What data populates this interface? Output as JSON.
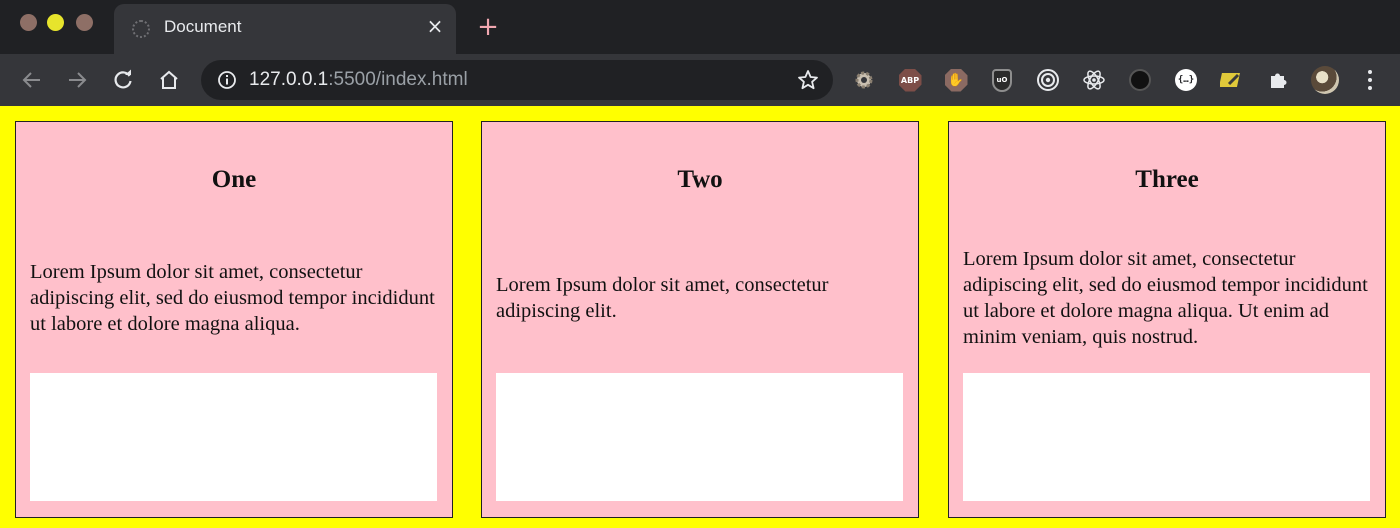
{
  "browser": {
    "tab_title": "Document",
    "tab_close": "×",
    "new_tab": "+",
    "url_host": "127.0.0.1",
    "url_rest": ":5500/index.html",
    "extensions": [
      "settings-gear",
      "adblock-plus",
      "hand-stop",
      "ublock-origin",
      "target",
      "react-devtools",
      "dark-reader",
      "json-viewer",
      "yellow-pencil",
      "extensions-puzzle"
    ],
    "colors": {
      "tabstrip": "#202124",
      "toolbar": "#35363a",
      "omnibox": "#202124"
    }
  },
  "cards": [
    {
      "title": "One",
      "text": "Lorem Ipsum dolor sit amet, consectetur adipiscing elit, sed do eiusmod tempor incididunt ut labore et dolore magna aliqua."
    },
    {
      "title": "Two",
      "text": "Lorem Ipsum dolor sit amet, consectetur adipiscing elit."
    },
    {
      "title": "Three",
      "text": "Lorem Ipsum dolor sit amet, consectetur adipiscing elit, sed do eiusmod tempor incididunt ut labore et dolore magna aliqua. Ut enim ad minim veniam, quis nostrud."
    }
  ],
  "colors": {
    "page_background": "#ffff00",
    "card_background": "#ffc0cb",
    "card_box": "#ffffff"
  }
}
